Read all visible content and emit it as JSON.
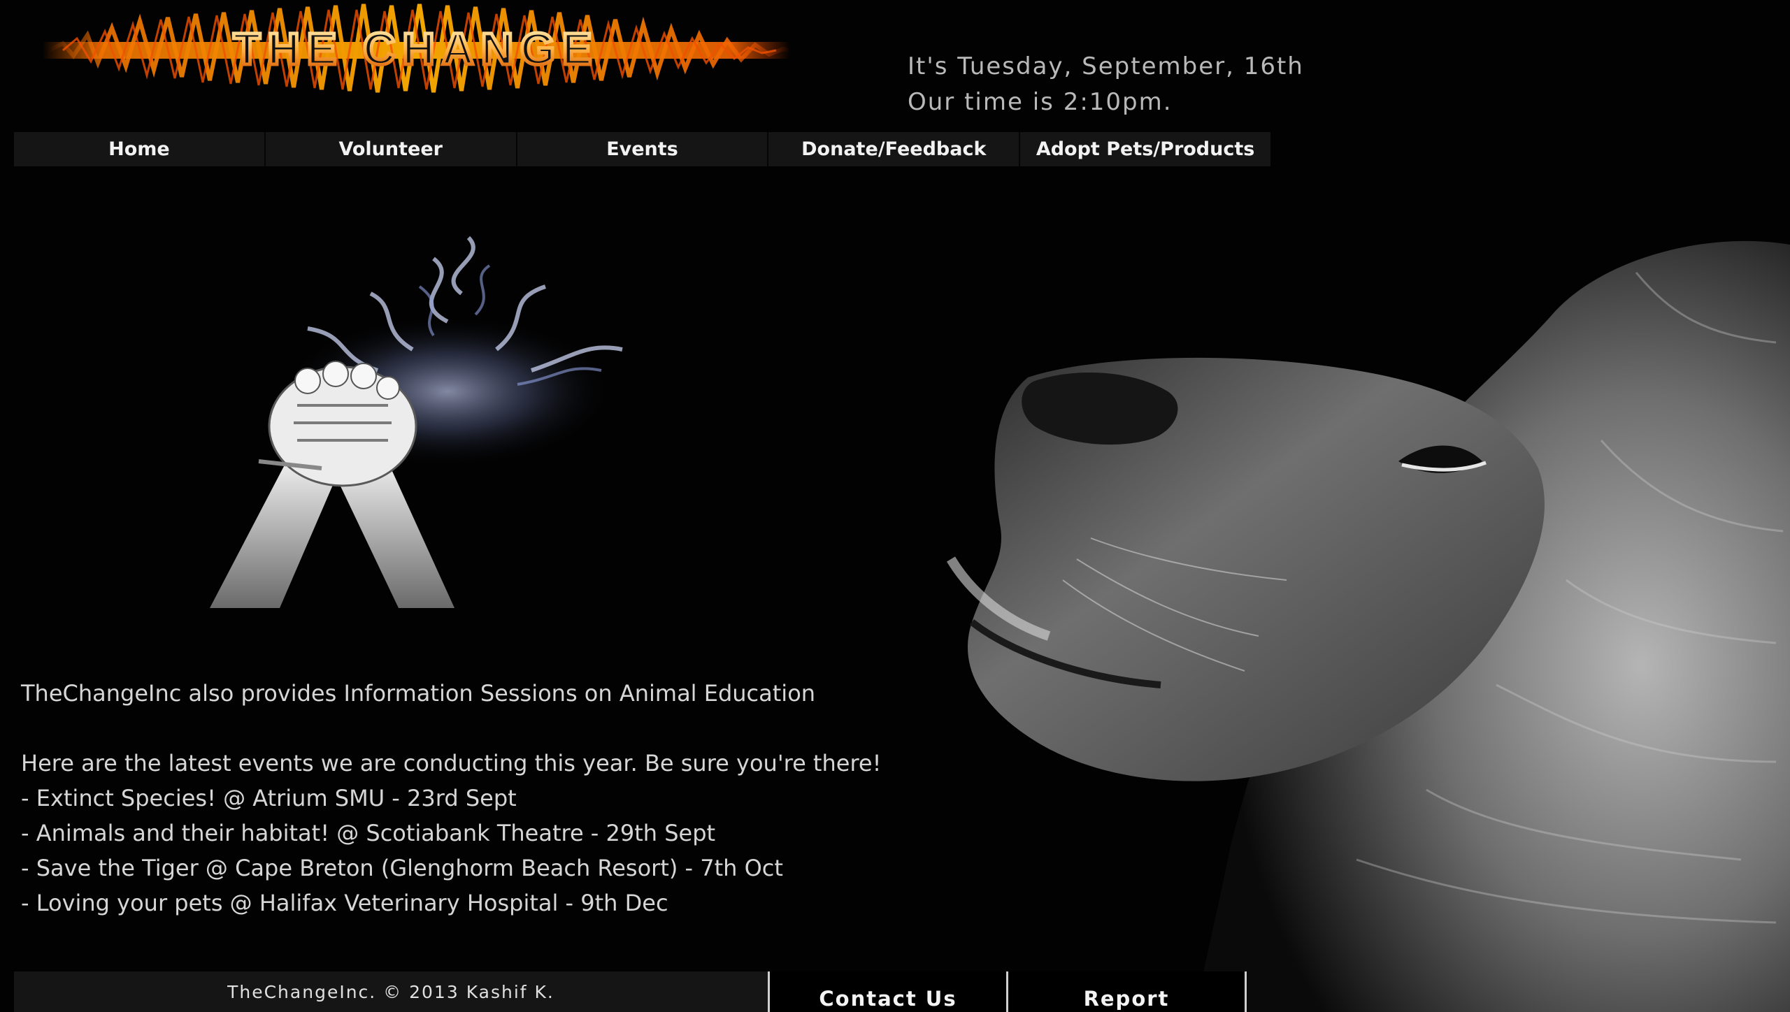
{
  "logo": {
    "text": "THE CHANGE"
  },
  "datetime": {
    "date_line": "It's Tuesday, September, 16th",
    "time_line": "Our time is 2:10pm."
  },
  "nav": {
    "items": [
      {
        "label": "Home"
      },
      {
        "label": "Volunteer"
      },
      {
        "label": "Events"
      },
      {
        "label": "Donate/Feedback"
      },
      {
        "label": "Adopt Pets/Products"
      }
    ]
  },
  "content": {
    "intro": "TheChangeInc also provides Information Sessions on Animal Education",
    "events_heading": "Here are the latest events we are conducting this year. Be sure you're there!",
    "events": [
      "- Extinct Species! @ Atrium SMU - 23rd Sept",
      "- Animals and their habitat! @ Scotiabank Theatre - 29th Sept",
      "- Save the Tiger @ Cape Breton (Glenghorm Beach Resort) - 7th Oct",
      "- Loving your pets @ Halifax Veterinary Hospital - 9th Dec"
    ]
  },
  "footer": {
    "copyright": "TheChangeInc. © 2013 Kashif K.",
    "contact_label": "Contact Us",
    "report_label": "Report"
  },
  "colors": {
    "background": "#020202",
    "nav_background": "#151515",
    "logo_fire": "#ff7a00",
    "text": "#d6d6d6"
  }
}
